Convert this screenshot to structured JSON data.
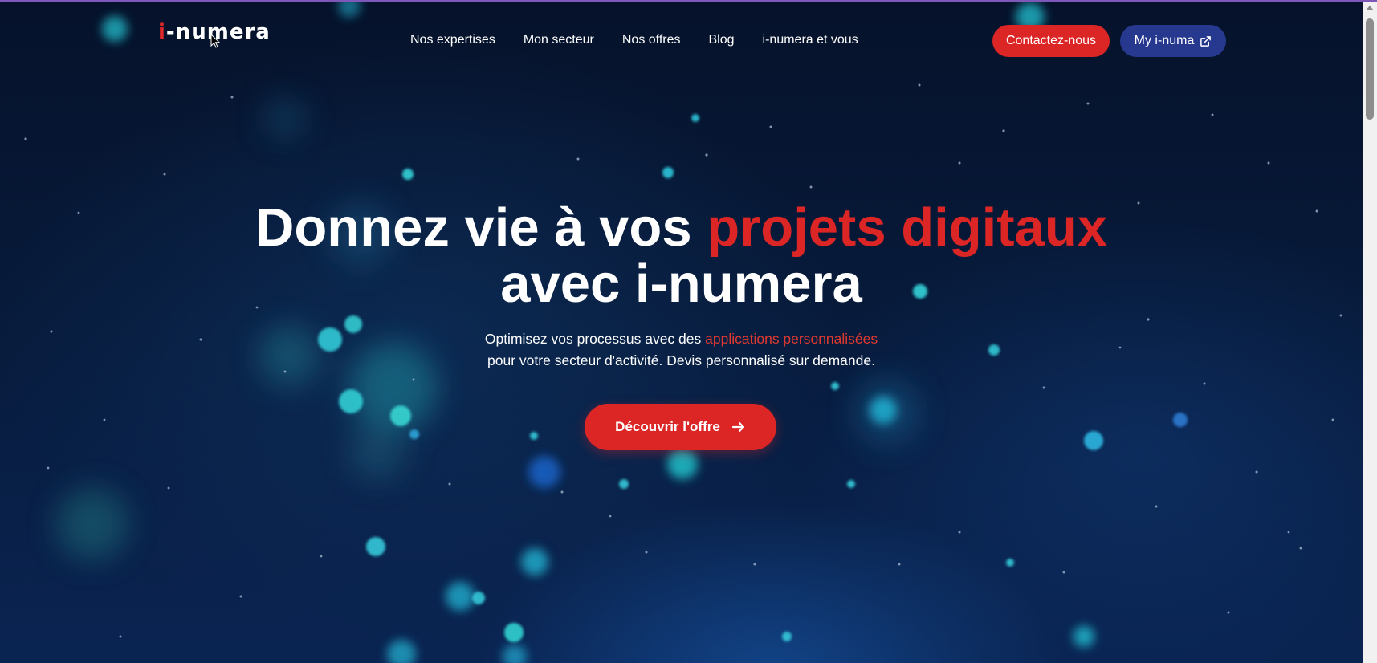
{
  "header": {
    "logo_first": "i",
    "logo_rest": "-numera",
    "nav_items": [
      "Nos expertises",
      "Mon secteur",
      "Nos offres",
      "Blog",
      "i-numera et vous"
    ],
    "contact_label": "Contactez-nous",
    "account_label": "My i-numa",
    "account_icon": "external-link-icon"
  },
  "hero": {
    "headline_start": "Donnez vie à vos",
    "headline_accent": "projets digitaux",
    "headline_end": "avec i-numera",
    "sub_start": "Optimisez vos processus avec des",
    "sub_accent": "applications personnalisées",
    "sub_end": "pour votre secteur d'activité. Devis personnalisé sur demande.",
    "cta_label": "Découvrir l'offre",
    "cta_icon": "arrow-right-icon"
  },
  "colors": {
    "accent_red": "#dc2626",
    "button_blue": "#26398f",
    "background": "#06122b"
  }
}
